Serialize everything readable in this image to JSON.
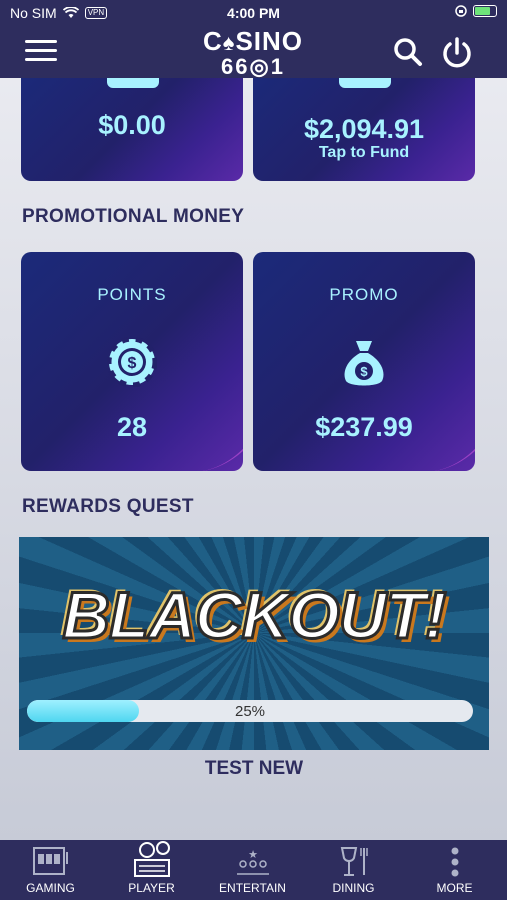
{
  "status": {
    "carrier": "No SIM",
    "vpn": "VPN",
    "time": "4:00 PM"
  },
  "header": {
    "logo_line1": "CSINO",
    "logo_line2": "6601"
  },
  "cards_top": [
    {
      "amount": "$0.00",
      "sub": ""
    },
    {
      "amount": "$2,094.91",
      "sub": "Tap to Fund"
    }
  ],
  "promo": {
    "heading": "PROMOTIONAL MONEY",
    "points": {
      "label": "POINTS",
      "value": "28"
    },
    "promo": {
      "label": "PROMO",
      "value": "$237.99"
    }
  },
  "quest": {
    "heading": "REWARDS QUEST",
    "banner": "BLACKOUT!",
    "progress": 0.25,
    "progress_label": "25%",
    "name": "TEST NEW"
  },
  "nav": [
    {
      "label": "GAMING",
      "icon": "slot-machine-icon"
    },
    {
      "label": "PLAYER",
      "icon": "player-icon"
    },
    {
      "label": "ENTERTAIN",
      "icon": "audience-icon"
    },
    {
      "label": "DINING",
      "icon": "dining-icon"
    },
    {
      "label": "MORE",
      "icon": "more-icon"
    }
  ],
  "colors": {
    "header": "#2e2d5e",
    "accent": "#a8f2ff",
    "progress": "#4fd6f0"
  }
}
